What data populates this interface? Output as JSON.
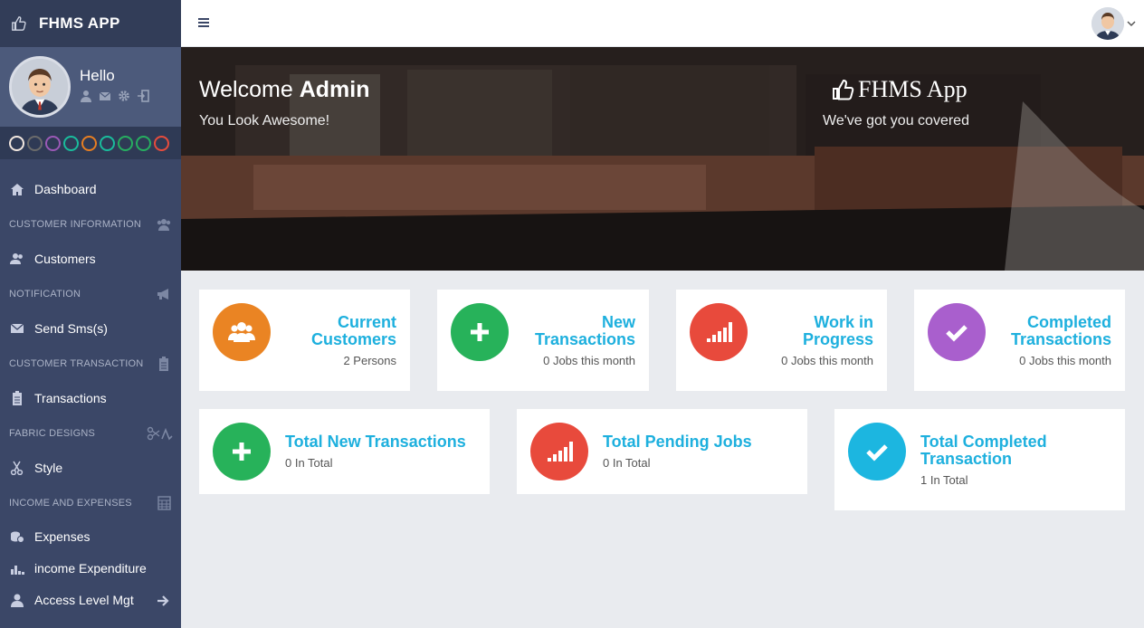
{
  "app": {
    "brand": "FHMS APP"
  },
  "profile": {
    "greeting": "Hello"
  },
  "swatches": [
    "#3a2a1e",
    "#5a5a5a",
    "#9b59b6",
    "#1abc9c",
    "#e67e22",
    "#1abc9c",
    "#27ae60",
    "#27ae60",
    "#e74c3c"
  ],
  "sidebar": {
    "dashboard": "Dashboard",
    "sections": {
      "customer_info": "CUSTOMER INFORMATION",
      "notification": "NOTIFICATION",
      "customer_transaction": "CUSTOMER TRANSACTION",
      "fabric_designs": "FABRIC DESIGNS",
      "income_expenses": "INCOME AND EXPENSES"
    },
    "items": {
      "customers": "Customers",
      "send_sms": "Send Sms(s)",
      "transactions": "Transactions",
      "style": "Style",
      "expenses": "Expenses",
      "income_expenditure": "income Expenditure",
      "access_level": "Access Level Mgt"
    }
  },
  "banner": {
    "welcome": "Welcome",
    "user": "Admin",
    "tagline": "You Look Awesome!",
    "brand": "FHMS App",
    "covered": "We've got you covered"
  },
  "cards": {
    "current_customers": {
      "title": "Current Customers",
      "sub": "2 Persons",
      "icon": "users-icon",
      "color": "#ea8423"
    },
    "new_transactions": {
      "title": "New Transactions",
      "sub": "0 Jobs this month",
      "icon": "plus-icon",
      "color": "#27b25a"
    },
    "work_in_progress": {
      "title": "Work in Progress",
      "sub": "0 Jobs this month",
      "icon": "signal-bars-icon",
      "color": "#e84a3c"
    },
    "completed_transactions": {
      "title": "Completed Transactions",
      "sub": "0 Jobs this month",
      "icon": "check-icon",
      "color": "#a95fcd"
    },
    "total_new": {
      "title": "Total New Transactions",
      "sub": "0 In Total",
      "icon": "plus-icon",
      "color": "#27b25a"
    },
    "total_pending": {
      "title": "Total Pending Jobs",
      "sub": "0 In Total",
      "icon": "signal-bars-icon",
      "color": "#e84a3c"
    },
    "total_completed": {
      "title": "Total Completed Transaction",
      "sub": "1 In Total",
      "icon": "check-icon",
      "color": "#1cb6e0"
    }
  }
}
